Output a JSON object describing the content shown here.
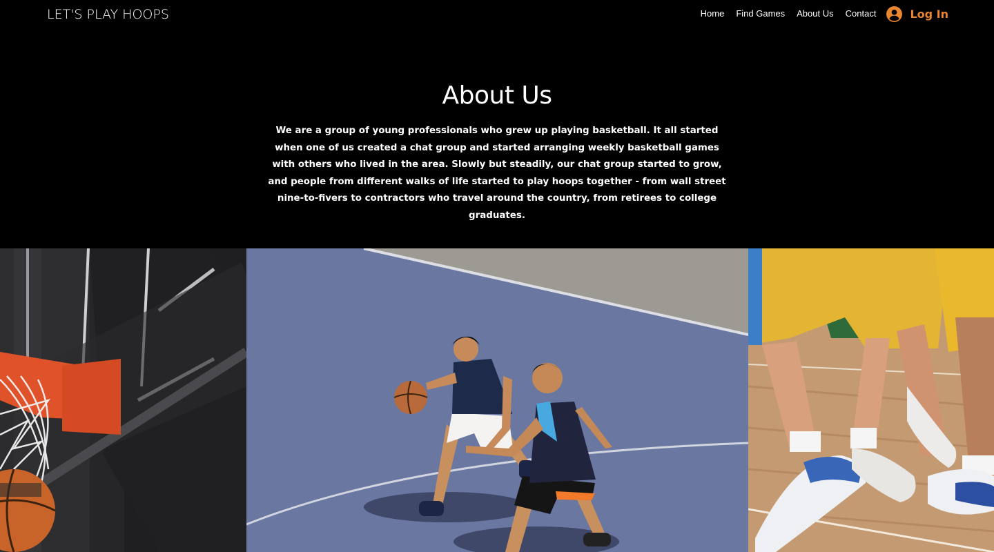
{
  "header": {
    "logo": "LET'S PLAY HOOPS",
    "nav": [
      "Home",
      "Find Games",
      "About Us",
      "Contact"
    ],
    "login_label": "Log In",
    "login_icon": "user-avatar-icon"
  },
  "about": {
    "title": "About Us",
    "body": "We are a group of young professionals who grew up playing basketball. It all started when one of us created a chat group and started arranging weekly basketball games with others who lived in the area. Slowly but steadily, our chat group started to grow, and people from different walks of life started to play hoops together - from wall street nine-to-fivers to contractors who travel around the country, from retirees to college graduates."
  },
  "colors": {
    "background": "#000000",
    "accent": "#e9852f",
    "text": "#ffffff"
  }
}
